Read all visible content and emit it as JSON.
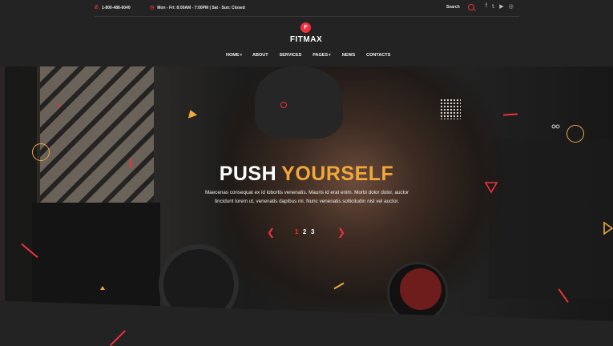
{
  "topbar": {
    "phone": "1-800-488-6040",
    "hours": "Mon - Fri: 8:00AM - 7:00PM | Sat - Sun: Closed",
    "search_label": "Search",
    "social_icons": [
      "facebook-icon",
      "twitter-icon",
      "youtube-icon",
      "instagram-icon"
    ]
  },
  "logo": {
    "badge": "F",
    "text": "FITMAX"
  },
  "nav": {
    "items": [
      {
        "label": "HOME",
        "dropdown": true
      },
      {
        "label": "ABOUT",
        "dropdown": false
      },
      {
        "label": "SERVICES",
        "dropdown": false
      },
      {
        "label": "PAGES",
        "dropdown": true
      },
      {
        "label": "NEWS",
        "dropdown": false
      },
      {
        "label": "CONTACTS",
        "dropdown": false
      }
    ]
  },
  "hero": {
    "title_part1": "PUSH",
    "title_part2": "YOURSELF",
    "description": "Maecenas consequat ex id lobortis venenatis. Mauris id erat enim. Morbi dolor dolor, auctor tincidunt lorem ut, venenatis dapibus mi. Nunc venenatis sollicitudin nisl vel auctor.",
    "slides": [
      "1",
      "2",
      "3"
    ],
    "active_slide": 1,
    "prev_arrow": "❮",
    "next_arrow": "❯"
  },
  "colors": {
    "accent_red": "#f0313d",
    "accent_orange": "#f2a73b",
    "background": "#232323"
  }
}
